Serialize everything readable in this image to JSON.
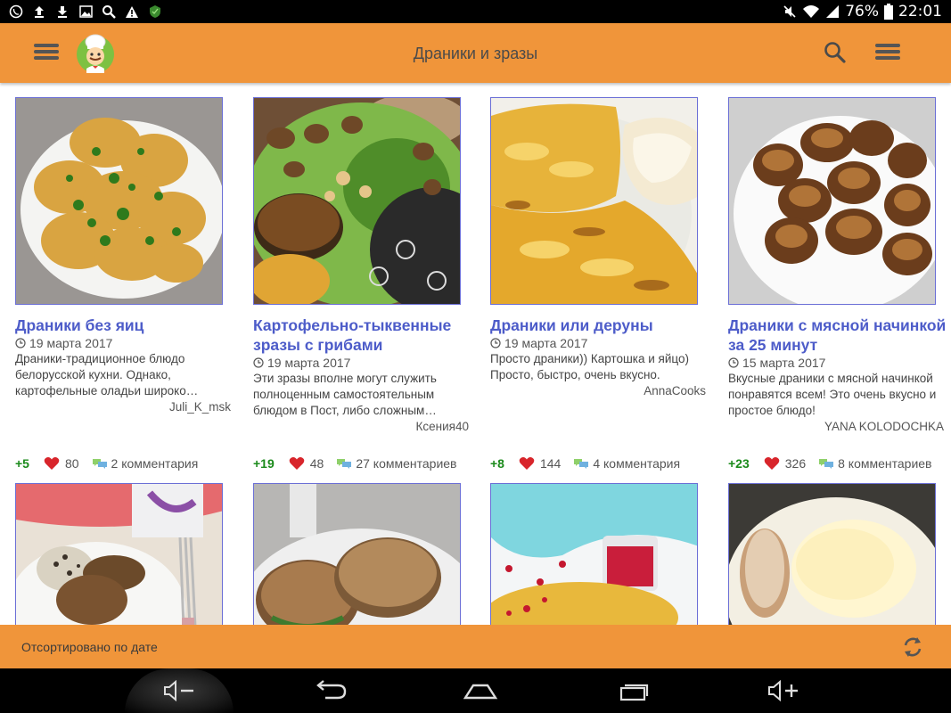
{
  "status_bar": {
    "battery": "76%",
    "time": "22:01",
    "icons": [
      "viber-icon",
      "upload-icon",
      "download-icon",
      "image-icon",
      "search-icon",
      "warning-icon",
      "shield-icon",
      "mute-icon",
      "wifi-icon",
      "signal-icon",
      "battery-icon"
    ]
  },
  "app_bar": {
    "title": "Драники и зразы",
    "colors": {
      "bar": "#f0953a",
      "title_text": "#4a4a4a",
      "link": "#4d5cc9"
    }
  },
  "recipes": [
    {
      "title": "Драники без яиц",
      "date": "19 марта 2017",
      "description": "Драники-традиционное блюдо белорусской кухни. Однако, картофельные оладьи широко…",
      "author": "Juli_K_msk",
      "rating": "+5",
      "likes": "80",
      "comments": "2 комментария"
    },
    {
      "title": "Картофельно-тыквенные зразы с грибами",
      "date": "19 марта 2017",
      "description": "Эти зразы вполне могут служить полноценным самостоятельным блюдом в Пост, либо сложным…",
      "author": "Ксения40",
      "rating": "+19",
      "likes": "48",
      "comments": "27 комментариев"
    },
    {
      "title": "Драники или деруны",
      "date": "19 марта 2017",
      "description": "Просто драники)) Картошка и яйцо) Просто, быстро, очень вкусно.",
      "author": "AnnaCooks",
      "rating": "+8",
      "likes": "144",
      "comments": "4 комментария"
    },
    {
      "title": "Драники с мясной начинкой за 25 минут",
      "date": "15 марта 2017",
      "description": "Вкусные драники с мясной начинкой понравятся всем! Это очень вкусно и простое блюдо!",
      "author": "YANA KOLODOCHKA",
      "rating": "+23",
      "likes": "326",
      "comments": "8 комментариев"
    }
  ],
  "sort_bar": {
    "label": "Отсортировано по дате"
  }
}
